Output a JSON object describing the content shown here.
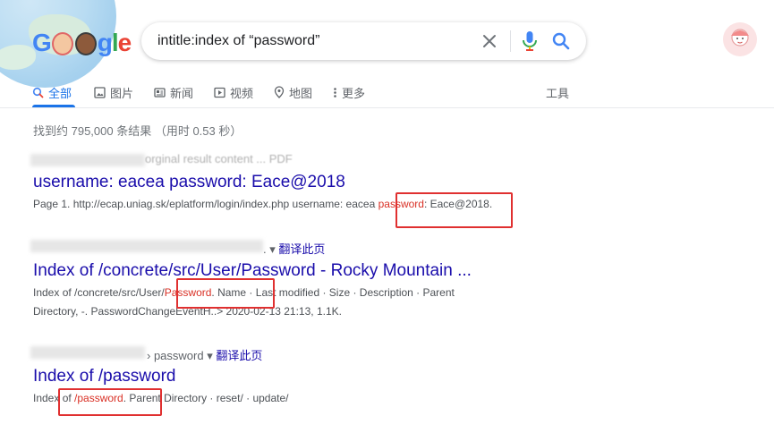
{
  "search": {
    "query": "intitle:index of “password”"
  },
  "logo": {
    "text": "Google"
  },
  "tabs": [
    {
      "label": "全部",
      "icon": "search-icon"
    },
    {
      "label": "图片",
      "icon": "image-icon"
    },
    {
      "label": "新闻",
      "icon": "news-icon"
    },
    {
      "label": "视频",
      "icon": "video-icon"
    },
    {
      "label": "地图",
      "icon": "map-pin-icon"
    },
    {
      "label": "更多",
      "icon": "more-dots-icon"
    }
  ],
  "tools_label": "工具",
  "stats": "找到约 795,000 条结果 （用时 0.53 秒）",
  "results": [
    {
      "cite_tail": "orginal result content ... PDF",
      "title": "username: eacea password: Eace@2018",
      "snippet": {
        "pre": "Page 1. http://ecap.uniag.sk/eplatform/login/index.php username: eacea ",
        "hl": "password",
        "post": ": Eace@2018."
      }
    },
    {
      "cite_tail": ". ▾",
      "translate": "翻译此页",
      "title": "Index of /concrete/src/User/Password - Rocky Mountain ...",
      "snippet": {
        "pre": "Index of /concrete/src/User/",
        "hl": "Password",
        "post": ". Name · Last modified · Size · Description · Parent",
        "line2": "Directory, -. PasswordChangeEventH..> 2020-02-13 21:13, 1.1K."
      }
    },
    {
      "cite_tail": "› password ▾",
      "translate": "翻译此页",
      "title": "Index of /password",
      "snippet": {
        "pre": "Index of ",
        "hl": "/password",
        "post": ". Parent Directory · reset/ · update/"
      }
    }
  ],
  "colors": {
    "link": "#1a0dab",
    "accent": "#1a73e8",
    "highlight": "#d93025",
    "annotation_box": "#e03030"
  }
}
